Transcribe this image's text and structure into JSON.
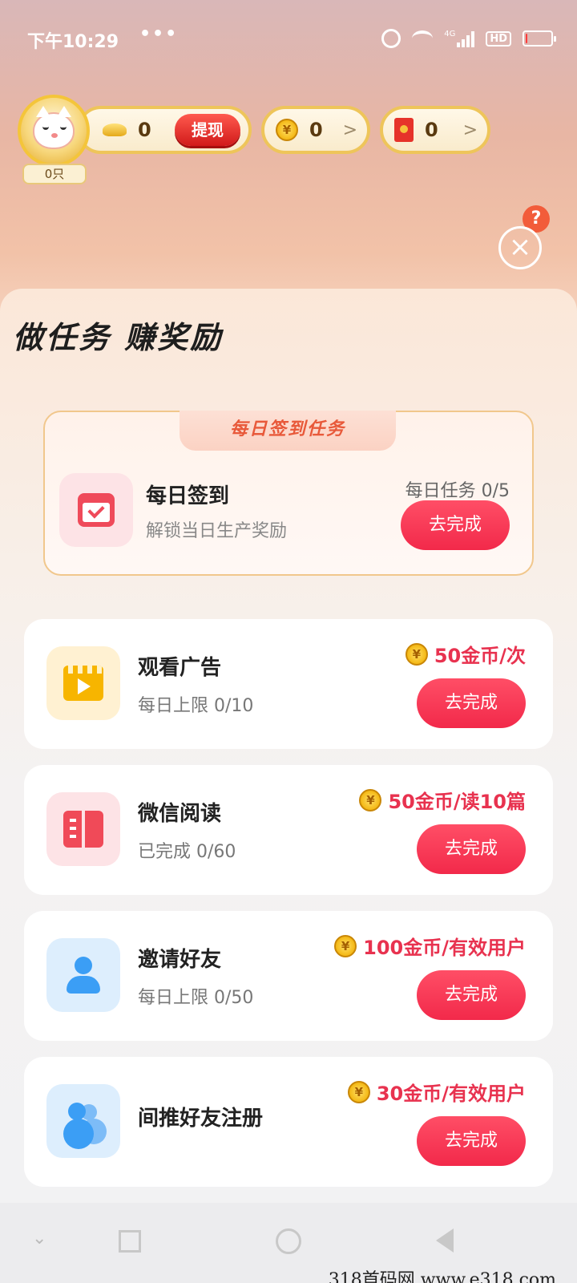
{
  "status_bar": {
    "time": "下午10:29",
    "dots": "•••",
    "network": "4G",
    "hd": "HD",
    "battery_level": 0.08,
    "battery_color": "#ff3b3b"
  },
  "header": {
    "avatar_badge": "0只",
    "gold_value": "0",
    "withdraw_label": "提现",
    "coin_value": "0",
    "coin_symbol": "¥",
    "redpacket_value": "0",
    "arrow": ">",
    "help_symbol": "?",
    "close_symbol": "×"
  },
  "panel": {
    "title": "做任务  赚奖励",
    "daily": {
      "tab_title": "每日签到任务",
      "title": "每日签到",
      "subtitle": "解锁当日生产奖励",
      "progress": "每日任务 0/5",
      "button": "去完成"
    },
    "tasks": [
      {
        "title": "观看广告",
        "subtitle": "每日上限 0/10",
        "reward": "50金币/次",
        "button": "去完成",
        "icon": "video-icon"
      },
      {
        "title": "微信阅读",
        "subtitle": "已完成 0/60",
        "reward": "50金币/读10篇",
        "button": "去完成",
        "icon": "book-icon"
      },
      {
        "title": "邀请好友",
        "subtitle": "每日上限 0/50",
        "reward": "100金币/有效用户",
        "button": "去完成",
        "icon": "person-icon"
      },
      {
        "title": "间推好友注册",
        "subtitle": "",
        "reward": "30金币/有效用户",
        "button": "去完成",
        "icon": "people-icon"
      }
    ]
  },
  "colors": {
    "accent_red": "#f2294a",
    "reward_text": "#e8324f",
    "gold": "#eec55a"
  },
  "watermark": "318首码网  www.e318.com"
}
